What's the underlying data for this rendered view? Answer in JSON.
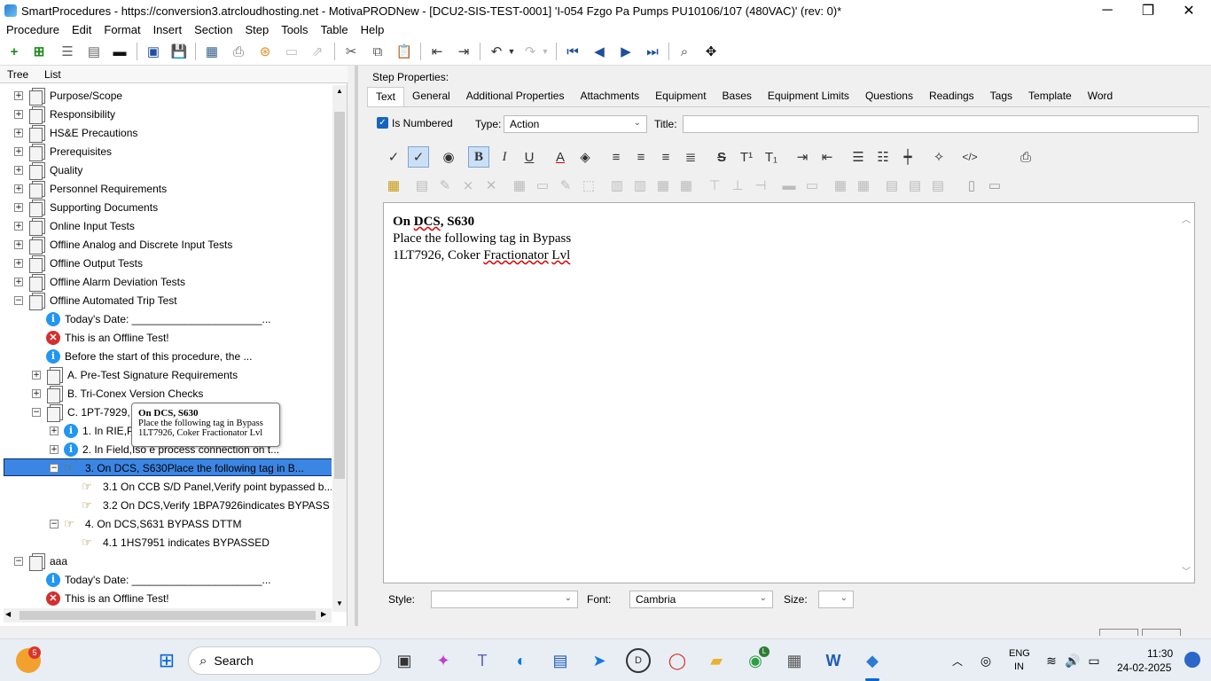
{
  "window": {
    "title": "SmartProcedures - https://conversion3.atrcloudhosting.net - MotivaPRODNew - [DCU2-SIS-TEST-0001] 'I-054 Fzgo Pa Pumps PU10106/107 (480VAC)' (rev: 0)*",
    "minimize": "─",
    "maximize": "❐",
    "close": "✕"
  },
  "menu": [
    "Procedure",
    "Edit",
    "Format",
    "Insert",
    "Section",
    "Step",
    "Tools",
    "Table",
    "Help"
  ],
  "left_tabs": {
    "tree": "Tree",
    "list": "List"
  },
  "tree": [
    {
      "label": "Purpose/Scope",
      "level": 0,
      "icon": "doc",
      "exp": "+"
    },
    {
      "label": "Responsibility",
      "level": 0,
      "icon": "doc",
      "exp": "+"
    },
    {
      "label": "HS&E Precautions",
      "level": 0,
      "icon": "doc",
      "exp": "+"
    },
    {
      "label": "Prerequisites",
      "level": 0,
      "icon": "doc",
      "exp": "+"
    },
    {
      "label": "Quality",
      "level": 0,
      "icon": "doc",
      "exp": "+"
    },
    {
      "label": "Personnel Requirements",
      "level": 0,
      "icon": "doc",
      "exp": "+"
    },
    {
      "label": "Supporting Documents",
      "level": 0,
      "icon": "doc",
      "exp": "+"
    },
    {
      "label": "Online Input Tests",
      "level": 0,
      "icon": "doc",
      "exp": "+"
    },
    {
      "label": "Offline Analog and Discrete Input Tests",
      "level": 0,
      "icon": "doc",
      "exp": "+"
    },
    {
      "label": "Offline Output Tests",
      "level": 0,
      "icon": "doc",
      "exp": "+"
    },
    {
      "label": "Offline Alarm Deviation Tests",
      "level": 0,
      "icon": "doc",
      "exp": "+"
    },
    {
      "label": "Offline Automated Trip Test",
      "level": 0,
      "icon": "doc",
      "exp": "−"
    },
    {
      "label": "Today's Date: ______________________...",
      "level": 1,
      "icon": "info",
      "exp": ""
    },
    {
      "label": "This is an Offline Test!",
      "level": 1,
      "icon": "err",
      "exp": ""
    },
    {
      "label": "Before the start of this procedure, the ...",
      "level": 1,
      "icon": "info",
      "exp": ""
    },
    {
      "label": "A. Pre-Test Signature Requirements",
      "level": 1,
      "icon": "doc",
      "exp": "+"
    },
    {
      "label": "B. Tri-Conex Version Checks",
      "level": 1,
      "icon": "doc",
      "exp": "+"
    },
    {
      "label": "C. 1PT-7929, B",
      "level": 1,
      "icon": "doc",
      "exp": "−"
    },
    {
      "label": "1. In RIE,P",
      "level": 2,
      "icon": "info",
      "exp": "+"
    },
    {
      "label": "2. In Field,Iso  e process connection on t...",
      "level": 2,
      "icon": "info",
      "exp": "+"
    },
    {
      "label": "3. On DCS, S630Place the following tag in B...",
      "level": 2,
      "icon": "hand",
      "exp": "−",
      "selected": true
    },
    {
      "label": "3.1 On CCB S/D Panel,Verify point bypassed b...",
      "level": 3,
      "icon": "hand",
      "exp": ""
    },
    {
      "label": "3.2 On DCS,Verify 1BPA7926indicates BYPASS",
      "level": 3,
      "icon": "hand",
      "exp": ""
    },
    {
      "label": "4. On DCS,S631 BYPASS DTTM",
      "level": 2,
      "icon": "hand",
      "exp": "−"
    },
    {
      "label": "4.1 1HS7951 indicates BYPASSED",
      "level": 3,
      "icon": "hand",
      "exp": ""
    },
    {
      "label": "aaa",
      "level": 0,
      "icon": "doc",
      "exp": "−"
    },
    {
      "label": "Today's Date: ______________________...",
      "level": 1,
      "icon": "info",
      "exp": ""
    },
    {
      "label": "This is an Offline Test!",
      "level": 1,
      "icon": "err",
      "exp": ""
    }
  ],
  "tooltip": {
    "title": "On DCS, S630",
    "line1": "Place the following tag in Bypass",
    "line2": "1LT7926, Coker Fractionator Lvl"
  },
  "step_properties": {
    "heading": "Step Properties:",
    "tabs": [
      "Text",
      "General",
      "Additional Properties",
      "Attachments",
      "Equipment",
      "Bases",
      "Equipment Limits",
      "Questions",
      "Readings",
      "Tags",
      "Template",
      "Word"
    ],
    "is_numbered_label": "Is Numbered",
    "type_label": "Type:",
    "type_value": "Action",
    "title_label": "Title:",
    "title_value": ""
  },
  "editor": {
    "line1_a": "On ",
    "line1_b": "DCS",
    "line1_c": ", S630",
    "line2": "Place the following tag in Bypass",
    "line3_a": "1LT7926, Coker ",
    "line3_b": "Fractionator",
    "line3_c": " ",
    "line3_d": "Lvl"
  },
  "format_bar": {
    "style_label": "Style:",
    "style_value": "",
    "font_label": "Font:",
    "font_value": "Cambria",
    "size_label": "Size:",
    "size_value": ""
  },
  "taskbar": {
    "notification_count": "5",
    "search_label": "Search",
    "lang1": "ENG",
    "lang2": "IN",
    "time": "11:30",
    "date": "24-02-2025",
    "chrome_badge": "L"
  }
}
